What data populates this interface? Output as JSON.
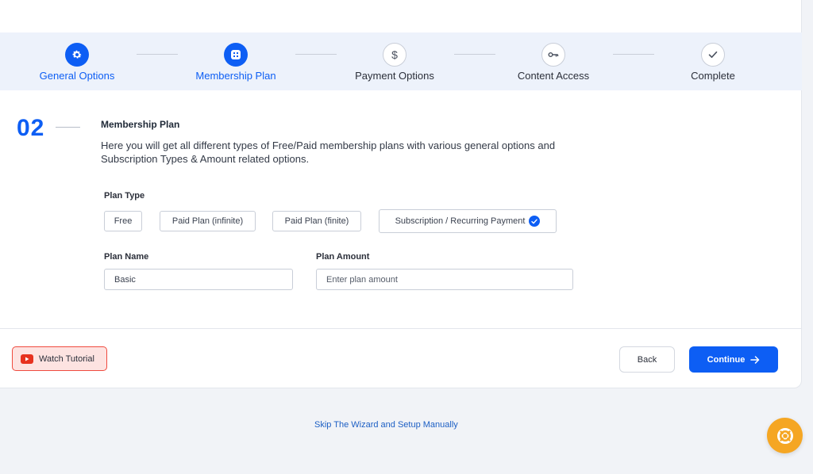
{
  "stepper": {
    "steps": [
      {
        "label": "General Options",
        "state": "active",
        "icon": "gear-icon"
      },
      {
        "label": "Membership Plan",
        "state": "active",
        "icon": "plan-icon"
      },
      {
        "label": "Payment Options",
        "state": "inactive",
        "icon": "dollar-icon"
      },
      {
        "label": "Content Access",
        "state": "inactive",
        "icon": "key-icon"
      },
      {
        "label": "Complete",
        "state": "inactive",
        "icon": "check-icon"
      }
    ]
  },
  "section": {
    "number": "02",
    "title": "Membership Plan",
    "description": "Here you will get all different types of Free/Paid membership plans with various general options and Subscription Types & Amount related options."
  },
  "plan_type": {
    "label": "Plan Type",
    "options": [
      {
        "label": "Free",
        "selected": false
      },
      {
        "label": "Paid Plan (infinite)",
        "selected": false
      },
      {
        "label": "Paid Plan (finite)",
        "selected": false
      },
      {
        "label": "Subscription / Recurring Payment",
        "selected": true
      }
    ]
  },
  "plan_name": {
    "label": "Plan Name",
    "value": "Basic"
  },
  "plan_amount": {
    "label": "Plan Amount",
    "placeholder": "Enter plan amount"
  },
  "footer": {
    "watch_label": "Watch Tutorial",
    "back_label": "Back",
    "continue_label": "Continue"
  },
  "skip_label": "Skip The Wizard and Setup Manually",
  "colors": {
    "accent": "#0d5ef4",
    "help_fab": "#f5a623",
    "video": "#e7321f"
  }
}
